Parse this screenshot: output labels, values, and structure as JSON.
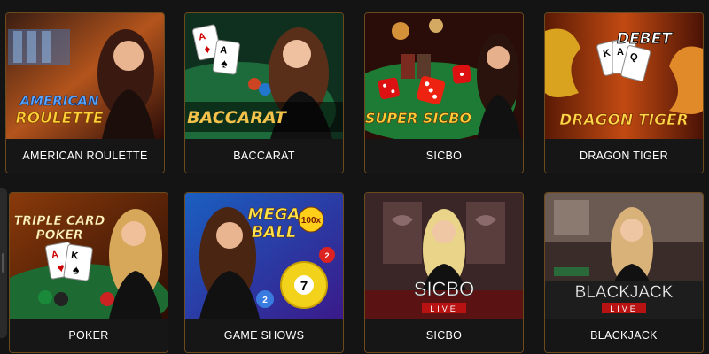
{
  "games": [
    {
      "name": "AMERICAN ROULETTE",
      "logo": [
        "AMERICAN",
        "ROULETTE"
      ]
    },
    {
      "name": "BACCARAT",
      "logo": [
        "BACCARAT"
      ]
    },
    {
      "name": "SICBO",
      "logo": [
        "SUPER SICBO"
      ]
    },
    {
      "name": "DRAGON TIGER",
      "logo": [
        "DRAGON TIGER"
      ],
      "brand": "DEBET"
    },
    {
      "name": "POKER",
      "logo": [
        "TRIPLE CARD",
        "POKER"
      ]
    },
    {
      "name": "GAME SHOWS",
      "logo": [
        "MEGA",
        "BALL"
      ],
      "badge": "100x"
    },
    {
      "name": "SICBO",
      "logo": [
        "SICBO"
      ],
      "live": "LIVE"
    },
    {
      "name": "BLACKJACK",
      "logo": [
        "BLACKJACK"
      ],
      "live": "LIVE"
    }
  ],
  "colors": {
    "background": "#141414",
    "card_border": "#6b4a1e",
    "label_text": "#ffffff"
  }
}
